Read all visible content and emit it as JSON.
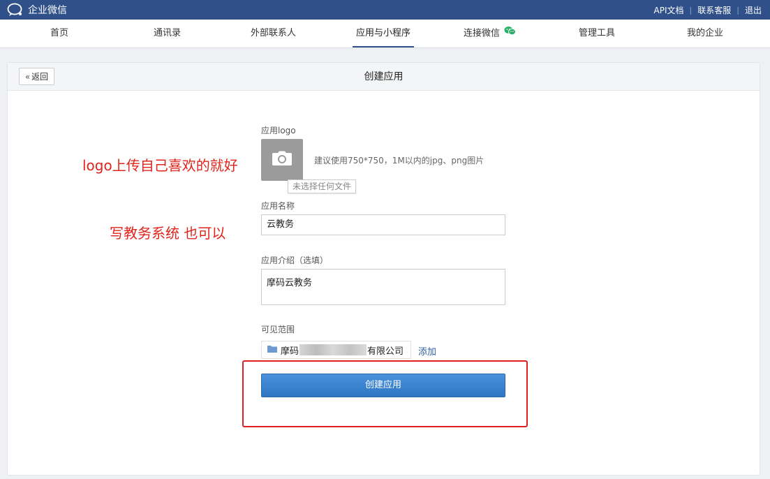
{
  "app": {
    "title": "企业微信"
  },
  "header_links": [
    "API文档",
    "联系客服",
    "退出"
  ],
  "nav": {
    "items": [
      "首页",
      "通讯录",
      "外部联系人",
      "应用与小程序",
      "连接微信",
      "管理工具",
      "我的企业"
    ],
    "active": "应用与小程序"
  },
  "panel": {
    "back_label": "返回",
    "title": "创建应用"
  },
  "form": {
    "logo_label": "应用logo",
    "logo_hint": "建议使用750*750，1M以内的jpg、png图片",
    "file_tooltip": "未选择任何文件",
    "name_label": "应用名称",
    "name_value": "云教务",
    "intro_label": "应用介绍（选填）",
    "intro_value": "摩码云教务",
    "scope_label": "可见范围",
    "scope_prefix": "摩码",
    "scope_suffix": "有限公司",
    "add_label": "添加",
    "submit_label": "创建应用"
  },
  "annotations": {
    "logo_note": "logo上传自己喜欢的就好",
    "name_note": "写教务系统 也可以"
  },
  "colors": {
    "topbar": "#2f5089",
    "primary_button": "#3b84d0",
    "annotation": "#e0241c",
    "wechat_green": "#2aae67"
  }
}
